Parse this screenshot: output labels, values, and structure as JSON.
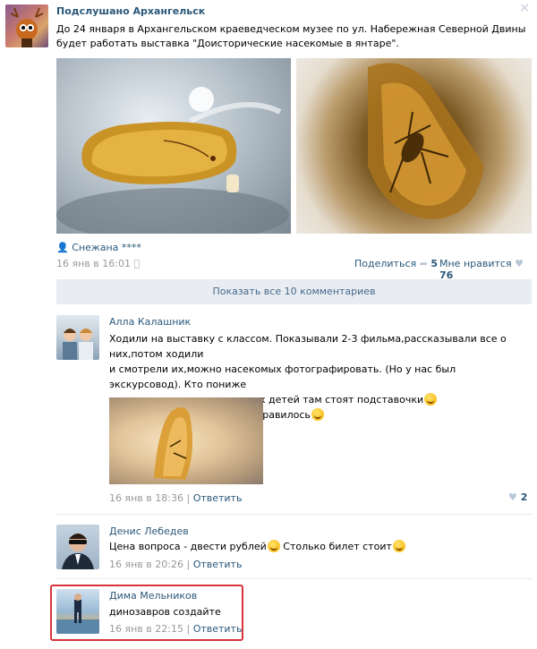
{
  "post": {
    "author": "Подслушано Архангельск",
    "text": "До 24 января в Архангельском краеведческом музее по ул. Набережная Северной Двины будет работать выставка \"Доисторические насекомые в янтаре\".",
    "signer": "Снежана ****",
    "date": "16 янв в 16:01",
    "share_label": "Поделиться",
    "share_count": "5",
    "like_label": "Мне нравится",
    "like_count": "76",
    "close_icon": "×"
  },
  "show_all_comments": "Показать все 10 комментариев",
  "comments": [
    {
      "author": "Алла Калашник",
      "lines": [
        "Ходили на выставку с классом. Показывали 2-3 фильма,рассказывали все о них,потом ходили",
        "и смотрели их,можно насекомых фотографировать. (Но у нас был экскурсовод). Кто пониже",
        "ростиком,да и для маленьких детей там стоят подставочки",
        "Вообщем,в целом ничего,понравилось"
      ],
      "date": "16 янв в 18:36",
      "reply": "Ответить",
      "likes": "2"
    },
    {
      "author": "Денис Лебедев",
      "text": "Цена вопроса - двести рублей",
      "text2": "Столько билет стоит",
      "date": "16 янв в 20:26",
      "reply": "Ответить"
    },
    {
      "author": "Дима Мельников",
      "text": "динозавров создайте",
      "date": "16 янв в 22:15",
      "reply": "Ответить"
    }
  ],
  "separator": "|",
  "colors": {
    "link": "#2b587a",
    "muted": "#999999",
    "highlight": "#d9343c",
    "button_bg": "#e9edf1"
  }
}
